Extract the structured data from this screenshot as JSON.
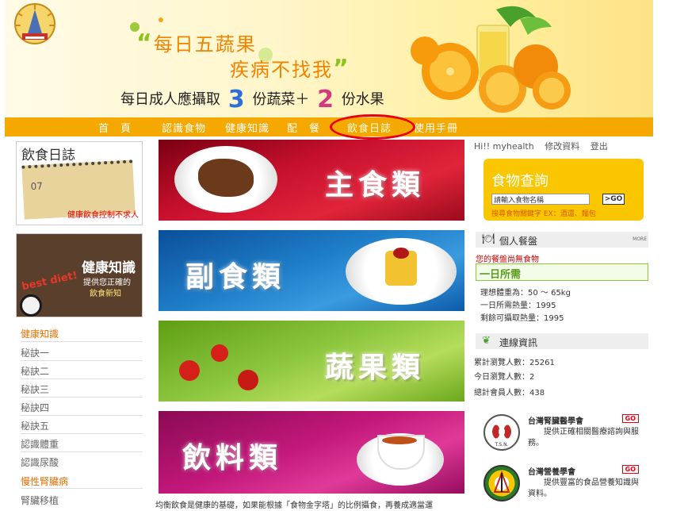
{
  "banner": {
    "slogan_line1": "每日五蔬果",
    "slogan_line2": "疾病不找我",
    "intake_prefix": "每日成人應攝取",
    "veg_count": "3",
    "veg_label": "份蔬菜＋",
    "fruit_count": "2",
    "fruit_label": "份水果"
  },
  "nav": {
    "items": [
      "首　頁",
      "認識食物",
      "健康知識",
      "配　餐",
      "飲食日誌",
      "使用手冊"
    ],
    "highlighted_item": "飲食日誌",
    "highlight_color": "#e60012"
  },
  "left": {
    "diary_title": "飲食日誌",
    "diary_month": "07",
    "diary_tag": "健康飲食控制不求人",
    "knowledge_title": "健康知識",
    "knowledge_sub1": "提供您正確的",
    "knowledge_sub2": "飲食新知",
    "knowledge_badge": "best diet!",
    "section1_title": "健康知識",
    "section1_links": [
      "秘訣一",
      "秘訣二",
      "秘訣三",
      "秘訣四",
      "秘訣五",
      "認識體重",
      "認識尿酸"
    ],
    "section2_title": "慢性腎臟病",
    "section2_links": [
      "腎臟移植"
    ]
  },
  "categories": [
    {
      "label": "主食類",
      "color": "#c8102e"
    },
    {
      "label": "副食類",
      "color": "#1f7ec8"
    },
    {
      "label": "蔬果類",
      "color": "#8cc63f"
    },
    {
      "label": "飲料類",
      "color": "#c2187a"
    }
  ],
  "bottom_text": "均衡飲食是健康的基礎，如果能根據「食物金字塔」的比例攝食，再養成適當運",
  "right": {
    "greeting": "Hi!! myhealth",
    "edit_link": "修改資料",
    "logout_link": "登出",
    "search_title": "食物查詢",
    "search_placeholder": "請輸入食物名稱",
    "search_go": ">GO",
    "search_tip": "搜尋食物關鍵字 EX：酒還、麵包",
    "meal_header": "個人餐盤",
    "more_label": "MORE",
    "meal_empty": "您的餐盤尚無食物",
    "daily_title": "一日所需",
    "ideal_weight": "理想體重為：50 ～ 65kg",
    "daily_calories": "一日所需熱量：1995",
    "remaining_calories": "剩餘可攝取熱量：1995",
    "stats_header": "連線資訊",
    "total_views": "累計瀏覽人數：25261",
    "today_views": "今日瀏覽人數：2",
    "total_members": "總計會員人數：438",
    "partners": [
      {
        "name": "台灣腎臟醫學會",
        "go": "GO",
        "desc": "提供正確相關醫療諮詢與服務。",
        "abbr": "T.S.N."
      },
      {
        "name": "台灣營養學會",
        "go": "GO",
        "desc": "提供豐富的食品營養知識與資料。",
        "abbr": ""
      }
    ]
  }
}
